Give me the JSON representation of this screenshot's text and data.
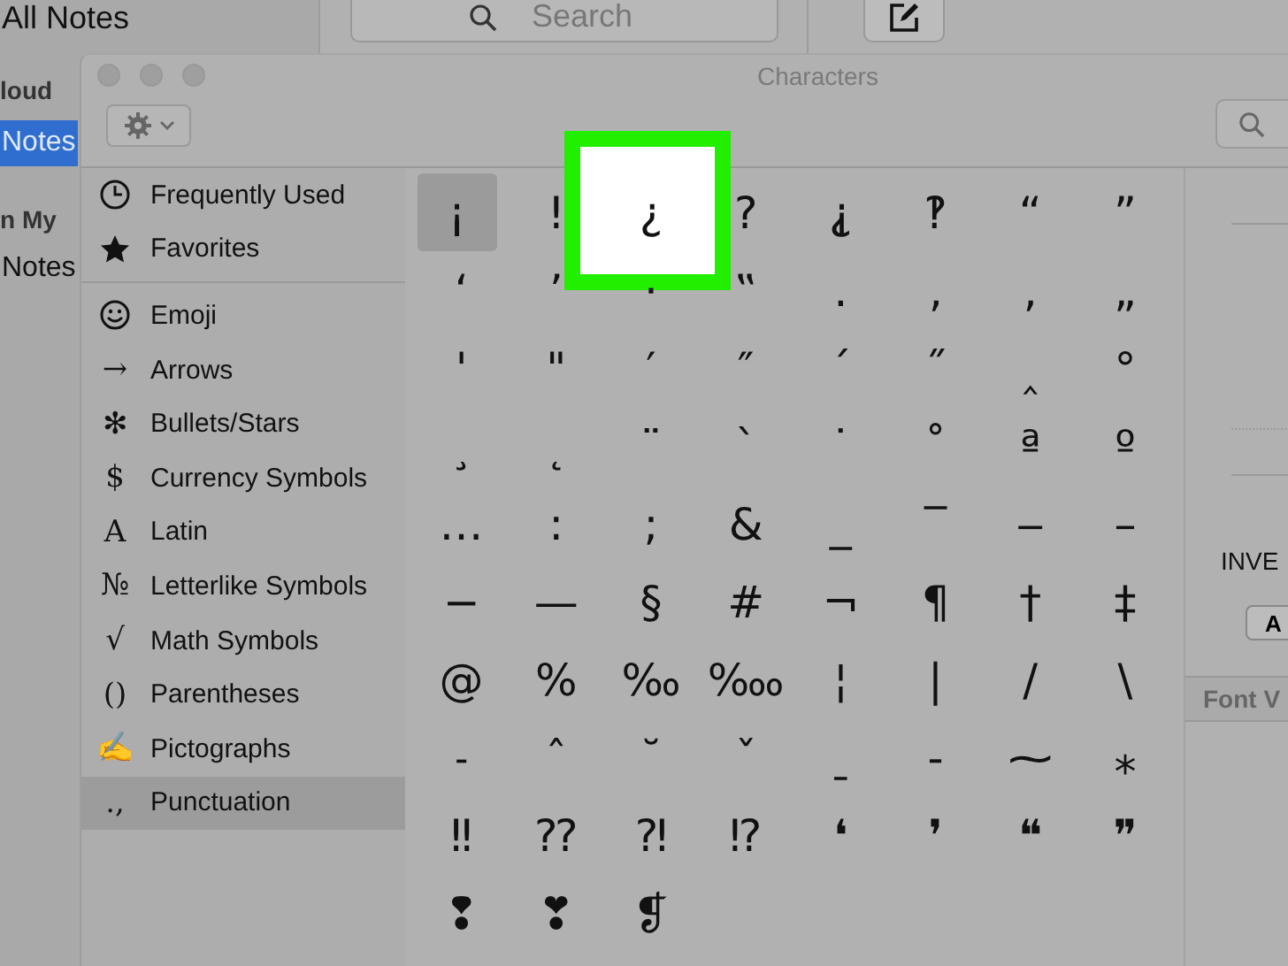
{
  "notes_app": {
    "sidebar_title": "All Notes",
    "search": {
      "placeholder": "Search"
    },
    "sections": [
      {
        "header": "loud",
        "items": [
          {
            "label": "Notes",
            "selected": true
          }
        ]
      },
      {
        "header": "n My",
        "items": [
          {
            "label": "Notes",
            "selected": false
          }
        ]
      }
    ]
  },
  "characters_window": {
    "title": "Characters",
    "sidebar": {
      "groups": [
        {
          "items": [
            {
              "kind": "clock",
              "label": "Frequently Used",
              "selected": false
            },
            {
              "kind": "star",
              "label": "Favorites",
              "selected": false
            }
          ]
        },
        {
          "items": [
            {
              "kind": "smiley",
              "label": "Emoji",
              "selected": false
            },
            {
              "kind": "glyph",
              "glyph": "→",
              "label": "Arrows",
              "selected": false
            },
            {
              "kind": "glyph",
              "glyph": "✻",
              "label": "Bullets/Stars",
              "selected": false
            },
            {
              "kind": "glyph",
              "glyph": "$",
              "label": "Currency Symbols",
              "selected": false
            },
            {
              "kind": "glyph",
              "glyph": "A",
              "label": "Latin",
              "selected": false
            },
            {
              "kind": "glyph",
              "glyph": "№",
              "label": "Letterlike Symbols",
              "selected": false
            },
            {
              "kind": "glyph",
              "glyph": "√",
              "label": "Math Symbols",
              "selected": false
            },
            {
              "kind": "glyph",
              "glyph": "()",
              "label": "Parentheses",
              "selected": false
            },
            {
              "kind": "glyph",
              "glyph": "✍",
              "label": "Pictographs",
              "selected": false
            },
            {
              "kind": "glyph",
              "glyph": ".,",
              "label": "Punctuation",
              "selected": true
            }
          ]
        }
      ]
    },
    "grid": {
      "rows": [
        [
          {
            "char": "¡",
            "selected": true,
            "highlighted": false
          },
          {
            "char": "!",
            "selected": false,
            "highlighted": false
          },
          {
            "char": "¿",
            "selected": false,
            "highlighted": true
          },
          {
            "char": "?",
            "selected": false,
            "highlighted": false
          },
          {
            "char": "⸘",
            "selected": false,
            "highlighted": false
          },
          {
            "char": "‽",
            "selected": false,
            "highlighted": false
          },
          {
            "char": "“",
            "selected": false,
            "highlighted": false
          },
          {
            "char": "”",
            "selected": false,
            "highlighted": false
          }
        ],
        [
          {
            "char": "‘",
            "selected": false,
            "highlighted": false
          },
          {
            "char": "’",
            "selected": false,
            "highlighted": false
          },
          {
            "char": "·",
            "selected": false,
            "highlighted": false
          },
          {
            "char": "‟",
            "selected": false,
            "highlighted": false
          },
          {
            "char": "․",
            "selected": false,
            "highlighted": false
          },
          {
            "char": "‚",
            "selected": false,
            "highlighted": false
          },
          {
            "char": ",",
            "selected": false,
            "highlighted": false
          },
          {
            "char": "„",
            "selected": false,
            "highlighted": false
          }
        ],
        [
          {
            "char": "'",
            "selected": false,
            "highlighted": false
          },
          {
            "char": "\"",
            "selected": false,
            "highlighted": false
          },
          {
            "char": "′",
            "selected": false,
            "highlighted": false
          },
          {
            "char": "″",
            "selected": false,
            "highlighted": false
          },
          {
            "char": "ˊ",
            "selected": false,
            "highlighted": false
          },
          {
            "char": "˝",
            "selected": false,
            "highlighted": false
          },
          {
            "char": "‸",
            "selected": false,
            "highlighted": false
          },
          {
            "char": "°",
            "selected": false,
            "highlighted": false
          }
        ],
        [
          {
            "char": "¸",
            "selected": false,
            "highlighted": false
          },
          {
            "char": "˛",
            "selected": false,
            "highlighted": false
          },
          {
            "char": "¨",
            "selected": false,
            "highlighted": false
          },
          {
            "char": "ˋ",
            "selected": false,
            "highlighted": false
          },
          {
            "char": "˙",
            "selected": false,
            "highlighted": false
          },
          {
            "char": "˚",
            "selected": false,
            "highlighted": false
          },
          {
            "char": "ª",
            "selected": false,
            "highlighted": false
          },
          {
            "char": "º",
            "selected": false,
            "highlighted": false
          }
        ],
        [
          {
            "char": "…",
            "selected": false,
            "highlighted": false
          },
          {
            "char": ":",
            "selected": false,
            "highlighted": false
          },
          {
            "char": ";",
            "selected": false,
            "highlighted": false
          },
          {
            "char": "&",
            "selected": false,
            "highlighted": false
          },
          {
            "char": "_",
            "selected": false,
            "highlighted": false
          },
          {
            "char": "‾",
            "selected": false,
            "highlighted": false
          },
          {
            "char": "‒",
            "selected": false,
            "highlighted": false
          },
          {
            "char": "–",
            "selected": false,
            "highlighted": false
          }
        ],
        [
          {
            "char": "−",
            "selected": false,
            "highlighted": false
          },
          {
            "char": "—",
            "selected": false,
            "highlighted": false
          },
          {
            "char": "§",
            "selected": false,
            "highlighted": false
          },
          {
            "char": "#",
            "selected": false,
            "highlighted": false
          },
          {
            "char": "¬",
            "selected": false,
            "highlighted": false
          },
          {
            "char": "¶",
            "selected": false,
            "highlighted": false
          },
          {
            "char": "†",
            "selected": false,
            "highlighted": false
          },
          {
            "char": "‡",
            "selected": false,
            "highlighted": false
          }
        ],
        [
          {
            "char": "@",
            "selected": false,
            "highlighted": false
          },
          {
            "char": "%",
            "selected": false,
            "highlighted": false
          },
          {
            "char": "‰",
            "selected": false,
            "highlighted": false
          },
          {
            "char": "‱",
            "selected": false,
            "highlighted": false
          },
          {
            "char": "¦",
            "selected": false,
            "highlighted": false
          },
          {
            "char": "|",
            "selected": false,
            "highlighted": false
          },
          {
            "char": "/",
            "selected": false,
            "highlighted": false
          },
          {
            "char": "\\",
            "selected": false,
            "highlighted": false
          }
        ],
        [
          {
            "char": "˗",
            "selected": false,
            "highlighted": false
          },
          {
            "char": "ˆ",
            "selected": false,
            "highlighted": false
          },
          {
            "char": "˘",
            "selected": false,
            "highlighted": false
          },
          {
            "char": "ˇ",
            "selected": false,
            "highlighted": false
          },
          {
            "char": "ˍ",
            "selected": false,
            "highlighted": false
          },
          {
            "char": "‐",
            "selected": false,
            "highlighted": false
          },
          {
            "char": "⁓",
            "selected": false,
            "highlighted": false
          },
          {
            "char": "⁎",
            "selected": false,
            "highlighted": false
          }
        ],
        [
          {
            "char": "‼",
            "selected": false,
            "highlighted": false
          },
          {
            "char": "⁇",
            "selected": false,
            "highlighted": false
          },
          {
            "char": "⁈",
            "selected": false,
            "highlighted": false
          },
          {
            "char": "⁉",
            "selected": false,
            "highlighted": false
          },
          {
            "char": "❛",
            "selected": false,
            "highlighted": false
          },
          {
            "char": "❜",
            "selected": false,
            "highlighted": false
          },
          {
            "char": "❝",
            "selected": false,
            "highlighted": false
          },
          {
            "char": "❞",
            "selected": false,
            "highlighted": false
          }
        ],
        [
          {
            "char": "❢",
            "selected": false,
            "highlighted": false
          },
          {
            "char": "❣",
            "selected": false,
            "highlighted": false
          },
          {
            "char": "❡",
            "selected": false,
            "highlighted": false
          }
        ]
      ]
    },
    "inspector": {
      "label": "INVE",
      "button": "A",
      "section_header": "Font V"
    }
  }
}
